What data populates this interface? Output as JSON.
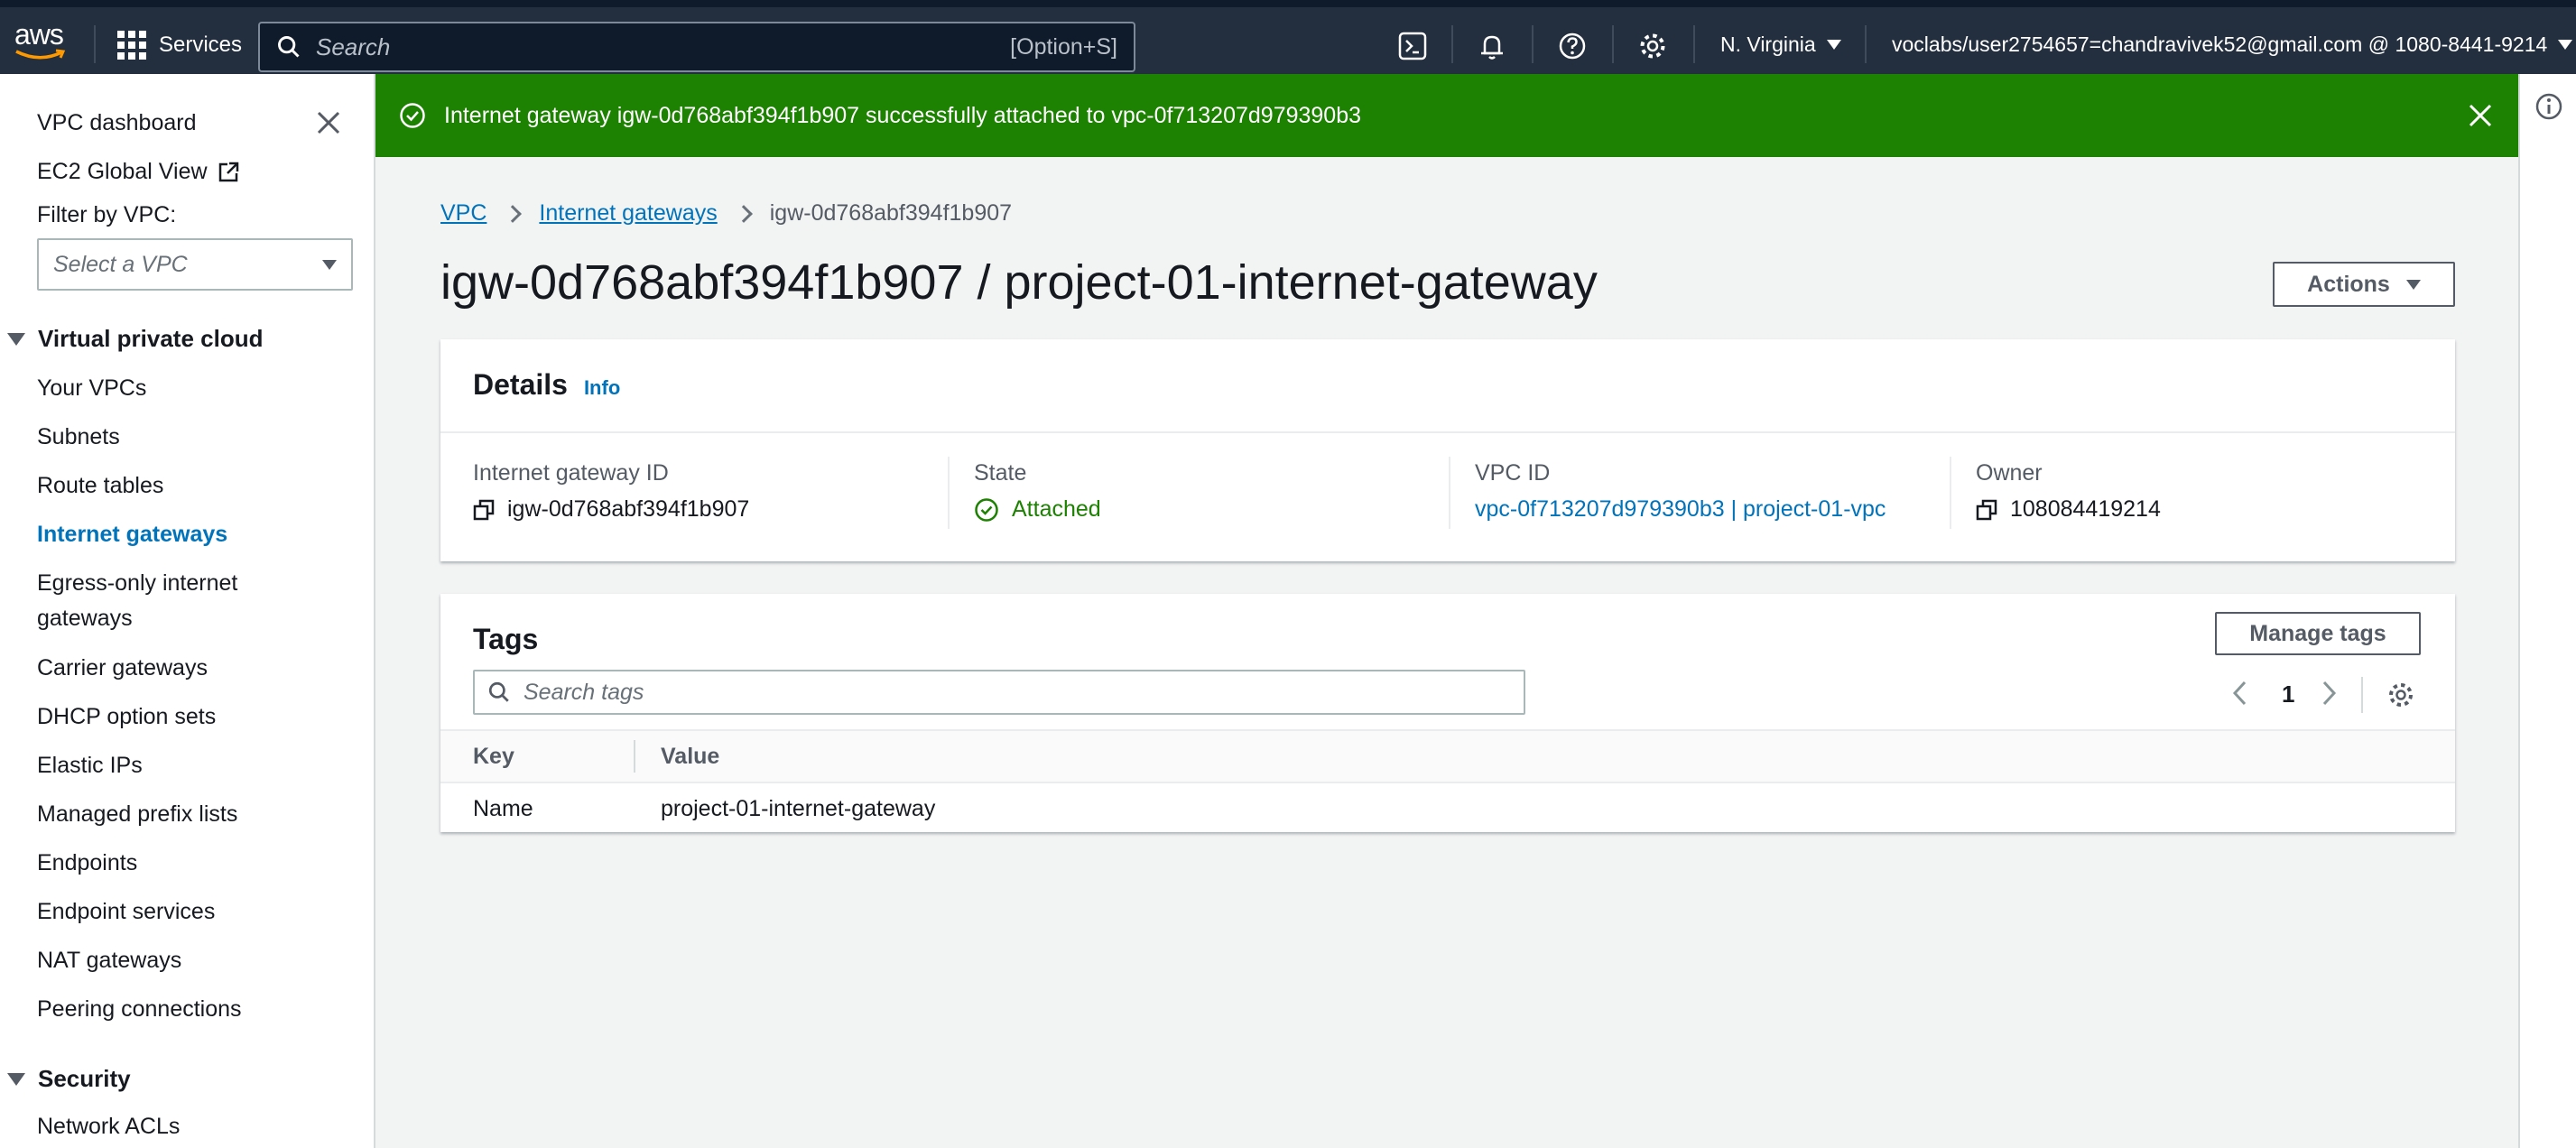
{
  "topnav": {
    "logo_text": "aws",
    "services_label": "Services",
    "search_placeholder": "Search",
    "search_shortcut": "[Option+S]",
    "region": "N. Virginia",
    "account": "voclabs/user2754657=chandravivek52@gmail.com @ 1080-8441-9214"
  },
  "sidebar": {
    "dashboard": "VPC dashboard",
    "ec2_global_view": "EC2 Global View",
    "filter_label": "Filter by VPC:",
    "filter_placeholder": "Select a VPC",
    "section_vpc": "Virtual private cloud",
    "items": [
      "Your VPCs",
      "Subnets",
      "Route tables",
      "Internet gateways",
      "Egress-only internet",
      "gateways",
      "Carrier gateways",
      "DHCP option sets",
      "Elastic IPs",
      "Managed prefix lists",
      "Endpoints",
      "Endpoint services",
      "NAT gateways",
      "Peering connections"
    ],
    "section_security": "Security",
    "security_items": [
      "Network ACLs"
    ]
  },
  "flash": {
    "message": "Internet gateway igw-0d768abf394f1b907 successfully attached to vpc-0f713207d979390b3"
  },
  "breadcrumb": {
    "root": "VPC",
    "parent": "Internet gateways",
    "current": "igw-0d768abf394f1b907"
  },
  "page": {
    "title": "igw-0d768abf394f1b907 / project-01-internet-gateway",
    "actions_label": "Actions"
  },
  "details": {
    "heading": "Details",
    "info": "Info",
    "igw_label": "Internet gateway ID",
    "igw_value": "igw-0d768abf394f1b907",
    "state_label": "State",
    "state_value": "Attached",
    "vpc_label": "VPC ID",
    "vpc_value": "vpc-0f713207d979390b3 | project-01-vpc",
    "owner_label": "Owner",
    "owner_value": "108084419214"
  },
  "tags": {
    "heading": "Tags",
    "manage_label": "Manage tags",
    "search_placeholder": "Search tags",
    "page_number": "1",
    "columns": [
      "Key",
      "Value"
    ],
    "rows": [
      {
        "key": "Name",
        "value": "project-01-internet-gateway"
      }
    ]
  },
  "colors": {
    "nav_bg": "#232f3e",
    "success": "#1d8102",
    "link": "#0073bb"
  }
}
